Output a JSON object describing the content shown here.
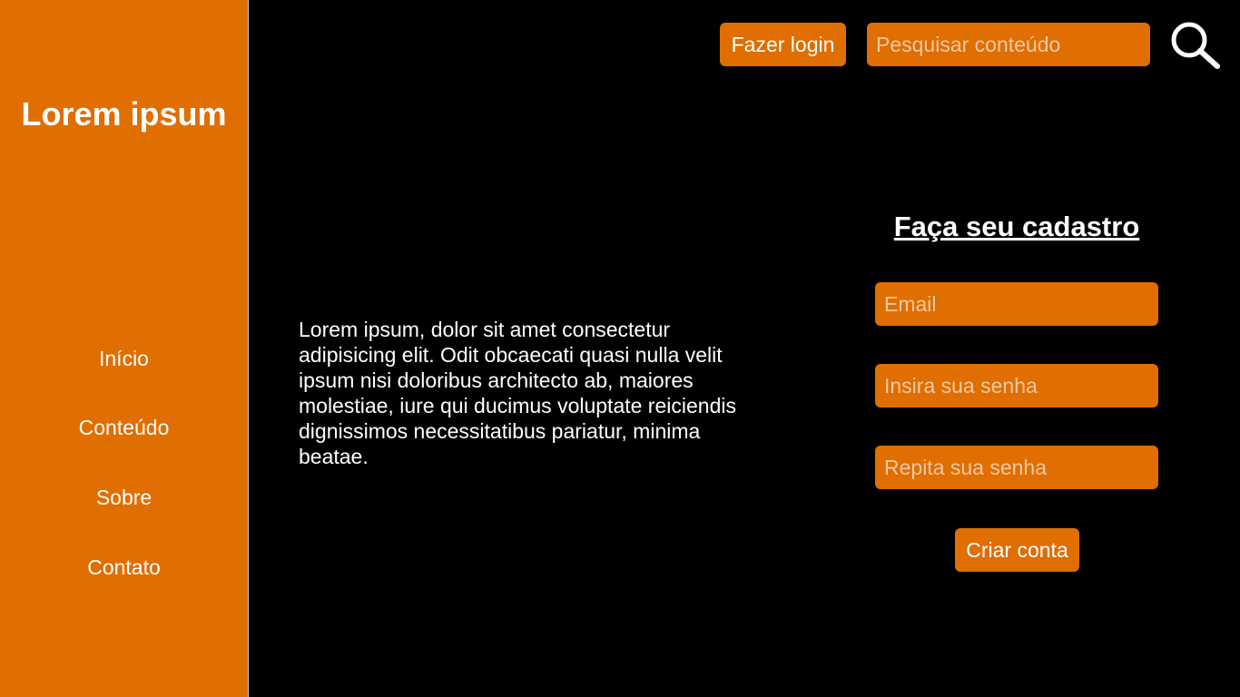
{
  "sidebar": {
    "brand": "Lorem ipsum",
    "items": [
      {
        "label": "Início"
      },
      {
        "label": "Conteúdo"
      },
      {
        "label": "Sobre"
      },
      {
        "label": "Contato"
      }
    ]
  },
  "header": {
    "login_label": "Fazer login",
    "search_placeholder": "Pesquisar conteúdo",
    "search_icon": "search-icon"
  },
  "main": {
    "lead_text": "Lorem ipsum, dolor sit amet consectetur adipisicing elit. Odit obcaecati quasi nulla velit ipsum nisi doloribus architecto ab, maiores molestiae, iure qui ducimus voluptate reiciendis dignissimos necessitatibus pariatur, minima beatae."
  },
  "signup": {
    "title": "Faça seu cadastro",
    "email_placeholder": "Email",
    "password_placeholder": "Insira sua senha",
    "repeat_password_placeholder": "Repita sua senha",
    "submit_label": "Criar conta"
  },
  "colors": {
    "accent": "#e06e00",
    "background": "#000000",
    "text": "#ffffff"
  }
}
